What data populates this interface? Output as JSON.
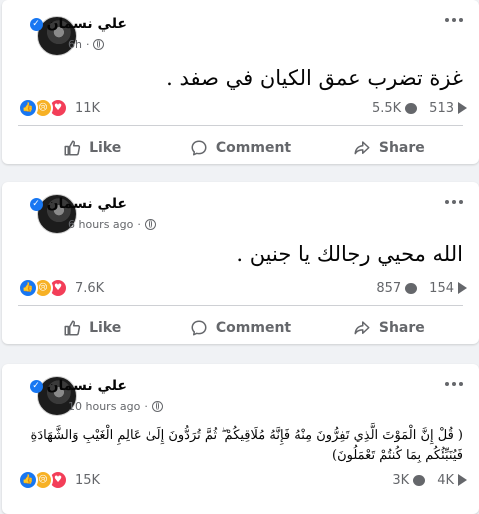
{
  "posts": [
    {
      "author": "علي نسمان",
      "time": "6h",
      "text": "غزة تضرب عمق الكيان في صفد .",
      "reaction_count": "11K",
      "comments": "5.5K",
      "shares": "513",
      "actions": {
        "like": "Like",
        "comment": "Comment",
        "share": "Share"
      }
    },
    {
      "author": "علي نسمان",
      "time": "6 hours ago",
      "text": "الله محيي رجالك يا جنين .",
      "reaction_count": "7.6K",
      "comments": "857",
      "shares": "154",
      "actions": {
        "like": "Like",
        "comment": "Comment",
        "share": "Share"
      }
    },
    {
      "author": "علي نسمان",
      "time": "10 hours ago",
      "text": "( قُلْ إِنَّ الْمَوْتَ الَّذِي تَفِرُّونَ مِنْهُ فَإِنَّهُ مُلَاقِيكُمْ ۖ ثُمَّ تُرَدُّونَ إِلَىٰ عَالِمِ الْغَيْبِ وَالشَّهَادَةِ فَيُنَبِّئُكُم بِمَا كُنتُمْ تَعْمَلُونَ)",
      "reaction_count": "15K",
      "comments": "3K",
      "shares": "4K"
    }
  ],
  "icons": {
    "reactions": [
      "like-reaction-icon",
      "sad-reaction-icon",
      "love-reaction-icon"
    ],
    "verified": "verified-badge-icon",
    "privacy": "globe-icon",
    "more": "more-options-icon"
  },
  "colors": {
    "brand": "#1877f2",
    "like": "#1877f2",
    "sad": "#f7b125",
    "love": "#f33e58",
    "muted": "#65676b",
    "background": "#f0f2f5"
  }
}
